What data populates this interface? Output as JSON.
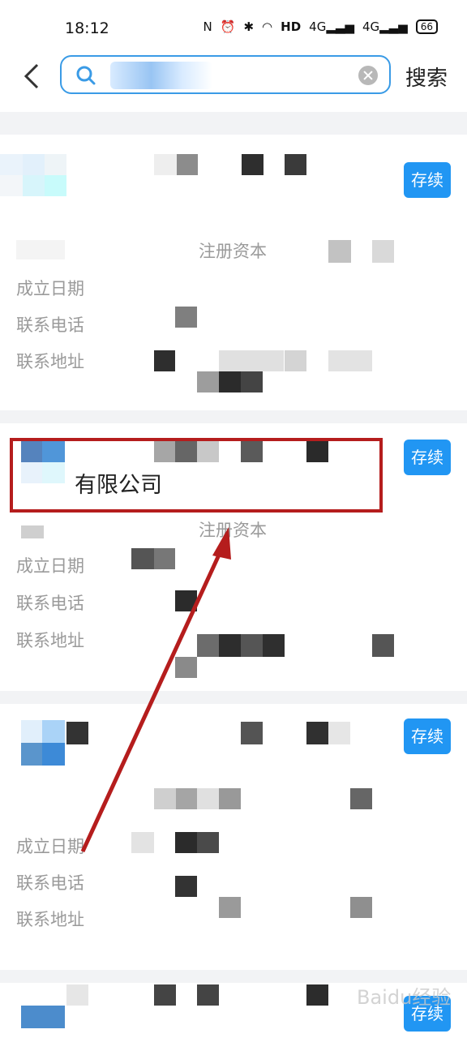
{
  "status_bar": {
    "time": "18:12",
    "battery": "66"
  },
  "search": {
    "back_label": "返回",
    "query": "",
    "search_label": "搜索"
  },
  "results": [
    {
      "status": "存续",
      "company_name": "",
      "registered_capital_label": "注册资本",
      "fields": [
        "成立日期",
        "联系电话",
        "联系地址"
      ]
    },
    {
      "status": "存续",
      "company_name": "有限公司",
      "registered_capital_label": "注册资本",
      "fields": [
        "成立日期",
        "联系电话",
        "联系地址"
      ]
    },
    {
      "status": "存续",
      "company_name": "",
      "registered_capital_label": "",
      "fields": [
        "成立日期",
        "联系电话",
        "联系地址"
      ]
    },
    {
      "status": "存续",
      "company_name": "",
      "registered_capital_label": "",
      "fields": []
    }
  ],
  "annotation": {
    "highlight_color": "#b51d1d"
  },
  "watermark": "Baidu经验"
}
